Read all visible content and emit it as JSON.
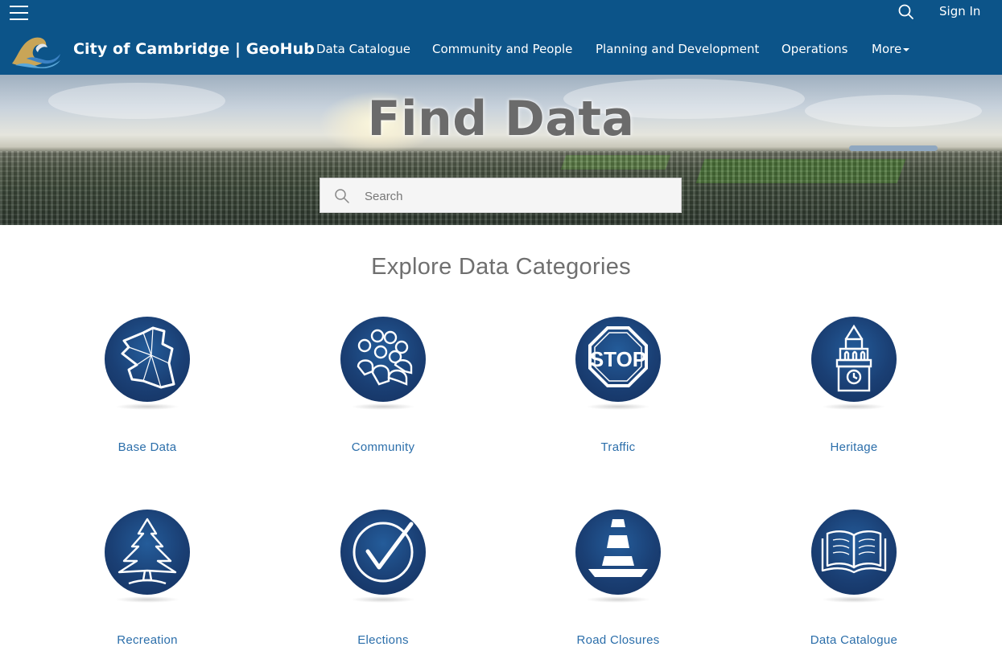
{
  "header": {
    "site_title": "City of Cambridge | GeoHub",
    "sign_in": "Sign In",
    "nav": [
      {
        "label": "Data Catalogue"
      },
      {
        "label": "Community and People"
      },
      {
        "label": "Planning and Development"
      },
      {
        "label": "Operations"
      },
      {
        "label": "More"
      }
    ],
    "colors": {
      "bar": "#0c5489",
      "text": "#ffffff"
    }
  },
  "hero": {
    "title": "Find Data",
    "search_placeholder": "Search"
  },
  "categories_section": {
    "title": "Explore Data Categories",
    "items": [
      {
        "label": "Base Data",
        "icon": "map-outline-icon"
      },
      {
        "label": "Community",
        "icon": "people-group-icon"
      },
      {
        "label": "Traffic",
        "icon": "stop-sign-icon"
      },
      {
        "label": "Heritage",
        "icon": "clock-tower-icon"
      },
      {
        "label": "Recreation",
        "icon": "pine-tree-icon"
      },
      {
        "label": "Elections",
        "icon": "checkmark-circle-icon"
      },
      {
        "label": "Road Closures",
        "icon": "traffic-cone-icon"
      },
      {
        "label": "Data Catalogue",
        "icon": "open-book-icon"
      }
    ],
    "colors": {
      "icon_disc": "#1a3f74",
      "label": "#2b6eaa",
      "title": "#6f6f6f"
    }
  },
  "stop_sign_text": "STOP"
}
